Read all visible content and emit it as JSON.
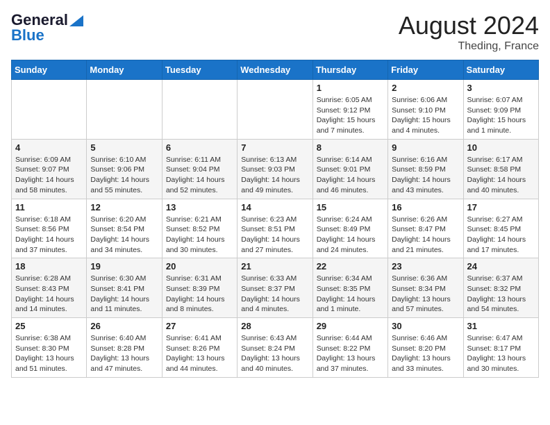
{
  "header": {
    "logo_line1": "General",
    "logo_line2": "Blue",
    "month": "August 2024",
    "location": "Theding, France"
  },
  "weekdays": [
    "Sunday",
    "Monday",
    "Tuesday",
    "Wednesday",
    "Thursday",
    "Friday",
    "Saturday"
  ],
  "weeks": [
    [
      {
        "day": "",
        "info": ""
      },
      {
        "day": "",
        "info": ""
      },
      {
        "day": "",
        "info": ""
      },
      {
        "day": "",
        "info": ""
      },
      {
        "day": "1",
        "info": "Sunrise: 6:05 AM\nSunset: 9:12 PM\nDaylight: 15 hours and 7 minutes."
      },
      {
        "day": "2",
        "info": "Sunrise: 6:06 AM\nSunset: 9:10 PM\nDaylight: 15 hours and 4 minutes."
      },
      {
        "day": "3",
        "info": "Sunrise: 6:07 AM\nSunset: 9:09 PM\nDaylight: 15 hours and 1 minute."
      }
    ],
    [
      {
        "day": "4",
        "info": "Sunrise: 6:09 AM\nSunset: 9:07 PM\nDaylight: 14 hours and 58 minutes."
      },
      {
        "day": "5",
        "info": "Sunrise: 6:10 AM\nSunset: 9:06 PM\nDaylight: 14 hours and 55 minutes."
      },
      {
        "day": "6",
        "info": "Sunrise: 6:11 AM\nSunset: 9:04 PM\nDaylight: 14 hours and 52 minutes."
      },
      {
        "day": "7",
        "info": "Sunrise: 6:13 AM\nSunset: 9:03 PM\nDaylight: 14 hours and 49 minutes."
      },
      {
        "day": "8",
        "info": "Sunrise: 6:14 AM\nSunset: 9:01 PM\nDaylight: 14 hours and 46 minutes."
      },
      {
        "day": "9",
        "info": "Sunrise: 6:16 AM\nSunset: 8:59 PM\nDaylight: 14 hours and 43 minutes."
      },
      {
        "day": "10",
        "info": "Sunrise: 6:17 AM\nSunset: 8:58 PM\nDaylight: 14 hours and 40 minutes."
      }
    ],
    [
      {
        "day": "11",
        "info": "Sunrise: 6:18 AM\nSunset: 8:56 PM\nDaylight: 14 hours and 37 minutes."
      },
      {
        "day": "12",
        "info": "Sunrise: 6:20 AM\nSunset: 8:54 PM\nDaylight: 14 hours and 34 minutes."
      },
      {
        "day": "13",
        "info": "Sunrise: 6:21 AM\nSunset: 8:52 PM\nDaylight: 14 hours and 30 minutes."
      },
      {
        "day": "14",
        "info": "Sunrise: 6:23 AM\nSunset: 8:51 PM\nDaylight: 14 hours and 27 minutes."
      },
      {
        "day": "15",
        "info": "Sunrise: 6:24 AM\nSunset: 8:49 PM\nDaylight: 14 hours and 24 minutes."
      },
      {
        "day": "16",
        "info": "Sunrise: 6:26 AM\nSunset: 8:47 PM\nDaylight: 14 hours and 21 minutes."
      },
      {
        "day": "17",
        "info": "Sunrise: 6:27 AM\nSunset: 8:45 PM\nDaylight: 14 hours and 17 minutes."
      }
    ],
    [
      {
        "day": "18",
        "info": "Sunrise: 6:28 AM\nSunset: 8:43 PM\nDaylight: 14 hours and 14 minutes."
      },
      {
        "day": "19",
        "info": "Sunrise: 6:30 AM\nSunset: 8:41 PM\nDaylight: 14 hours and 11 minutes."
      },
      {
        "day": "20",
        "info": "Sunrise: 6:31 AM\nSunset: 8:39 PM\nDaylight: 14 hours and 8 minutes."
      },
      {
        "day": "21",
        "info": "Sunrise: 6:33 AM\nSunset: 8:37 PM\nDaylight: 14 hours and 4 minutes."
      },
      {
        "day": "22",
        "info": "Sunrise: 6:34 AM\nSunset: 8:35 PM\nDaylight: 14 hours and 1 minute."
      },
      {
        "day": "23",
        "info": "Sunrise: 6:36 AM\nSunset: 8:34 PM\nDaylight: 13 hours and 57 minutes."
      },
      {
        "day": "24",
        "info": "Sunrise: 6:37 AM\nSunset: 8:32 PM\nDaylight: 13 hours and 54 minutes."
      }
    ],
    [
      {
        "day": "25",
        "info": "Sunrise: 6:38 AM\nSunset: 8:30 PM\nDaylight: 13 hours and 51 minutes."
      },
      {
        "day": "26",
        "info": "Sunrise: 6:40 AM\nSunset: 8:28 PM\nDaylight: 13 hours and 47 minutes."
      },
      {
        "day": "27",
        "info": "Sunrise: 6:41 AM\nSunset: 8:26 PM\nDaylight: 13 hours and 44 minutes."
      },
      {
        "day": "28",
        "info": "Sunrise: 6:43 AM\nSunset: 8:24 PM\nDaylight: 13 hours and 40 minutes."
      },
      {
        "day": "29",
        "info": "Sunrise: 6:44 AM\nSunset: 8:22 PM\nDaylight: 13 hours and 37 minutes."
      },
      {
        "day": "30",
        "info": "Sunrise: 6:46 AM\nSunset: 8:20 PM\nDaylight: 13 hours and 33 minutes."
      },
      {
        "day": "31",
        "info": "Sunrise: 6:47 AM\nSunset: 8:17 PM\nDaylight: 13 hours and 30 minutes."
      }
    ]
  ]
}
